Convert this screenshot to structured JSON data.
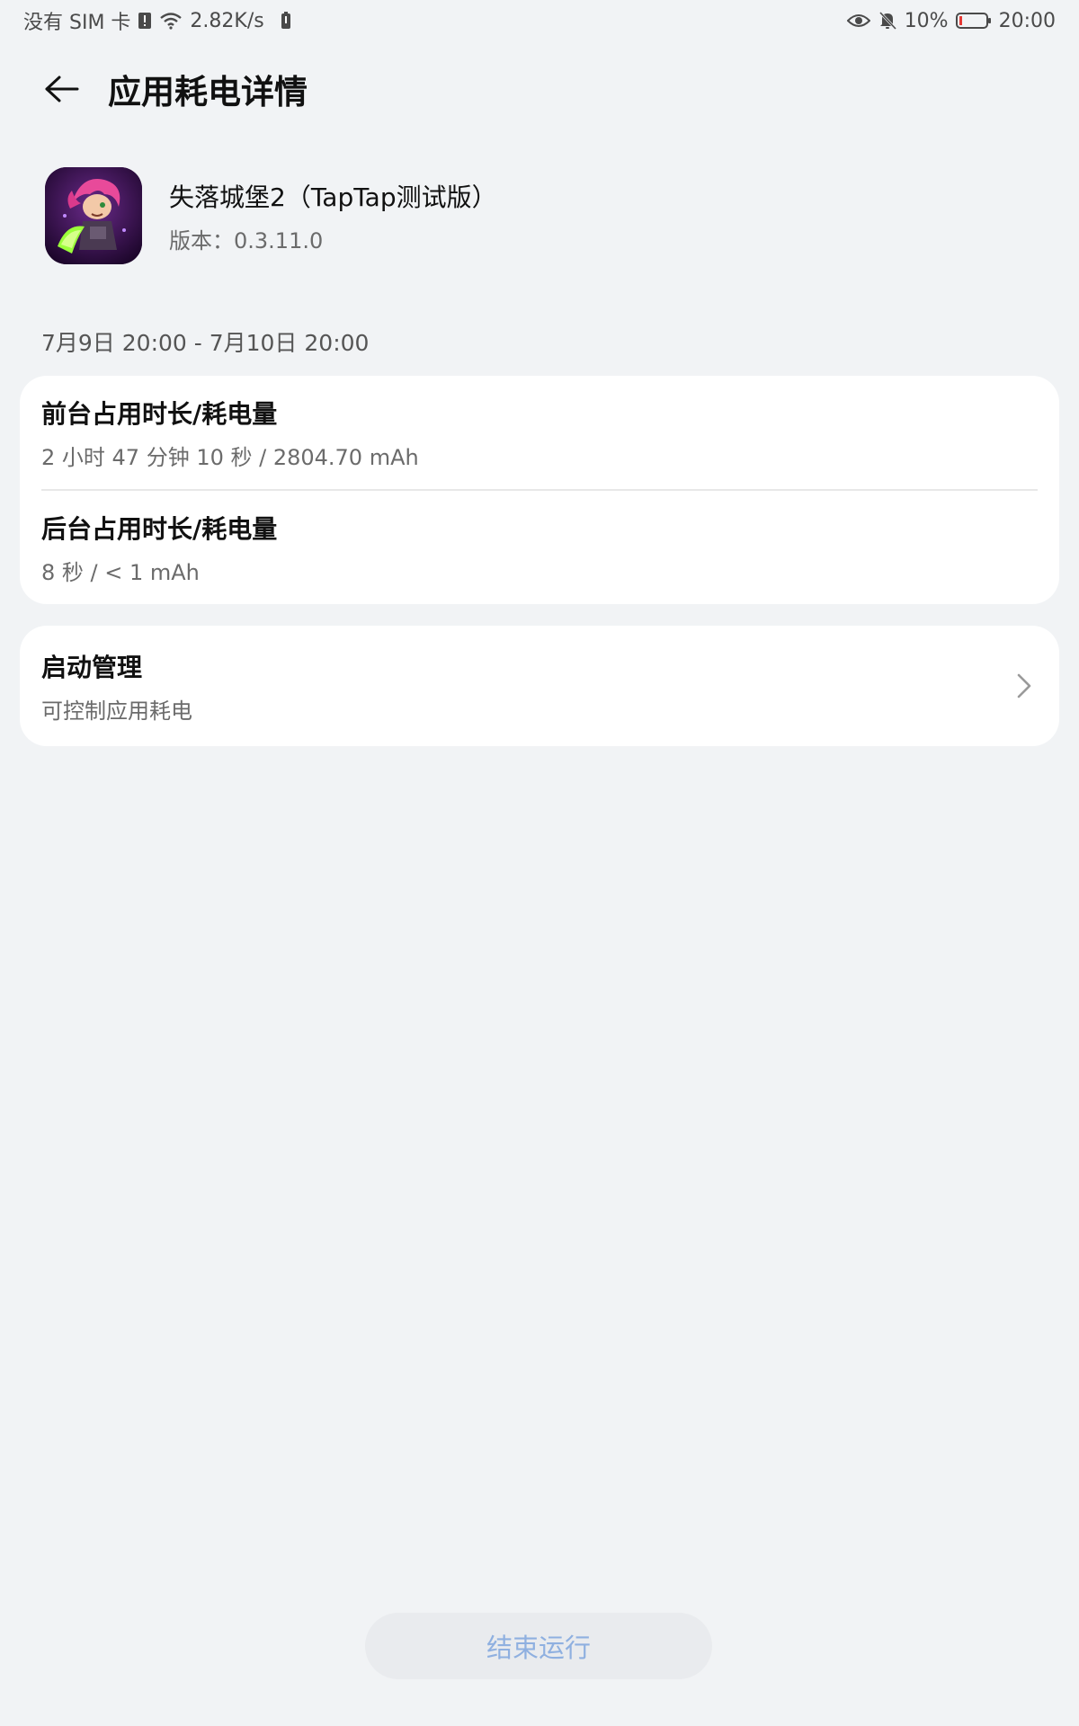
{
  "status_bar": {
    "carrier": "没有 SIM 卡",
    "net_speed": "2.82K/s",
    "battery_percent": "10%",
    "time": "20:00",
    "icons": [
      "sim-alert-icon",
      "wifi-icon",
      "battery-saver-icon",
      "eye-comfort-icon",
      "mute-bell-icon",
      "battery-icon"
    ]
  },
  "header": {
    "title": "应用耗电详情",
    "back_icon": "arrow-left-icon"
  },
  "app": {
    "name": "失落城堡2（TapTap测试版）",
    "version": "版本：0.3.11.0"
  },
  "date_range": "7月9日 20:00 - 7月10日 20:00",
  "usage": {
    "foreground": {
      "title": "前台占用时长/耗电量",
      "value": "2 小时 47 分钟 10 秒 / 2804.70 mAh"
    },
    "background": {
      "title": "后台占用时长/耗电量",
      "value": "8 秒 / < 1 mAh"
    }
  },
  "launch_management": {
    "title": "启动管理",
    "subtitle": "可控制应用耗电",
    "icon": "chevron-right-icon"
  },
  "end_button": {
    "label": "结束运行"
  },
  "colors": {
    "background": "#f1f3f5",
    "card": "#ffffff",
    "end_button_text": "#8fb0e0",
    "battery_low": "#e53935"
  }
}
